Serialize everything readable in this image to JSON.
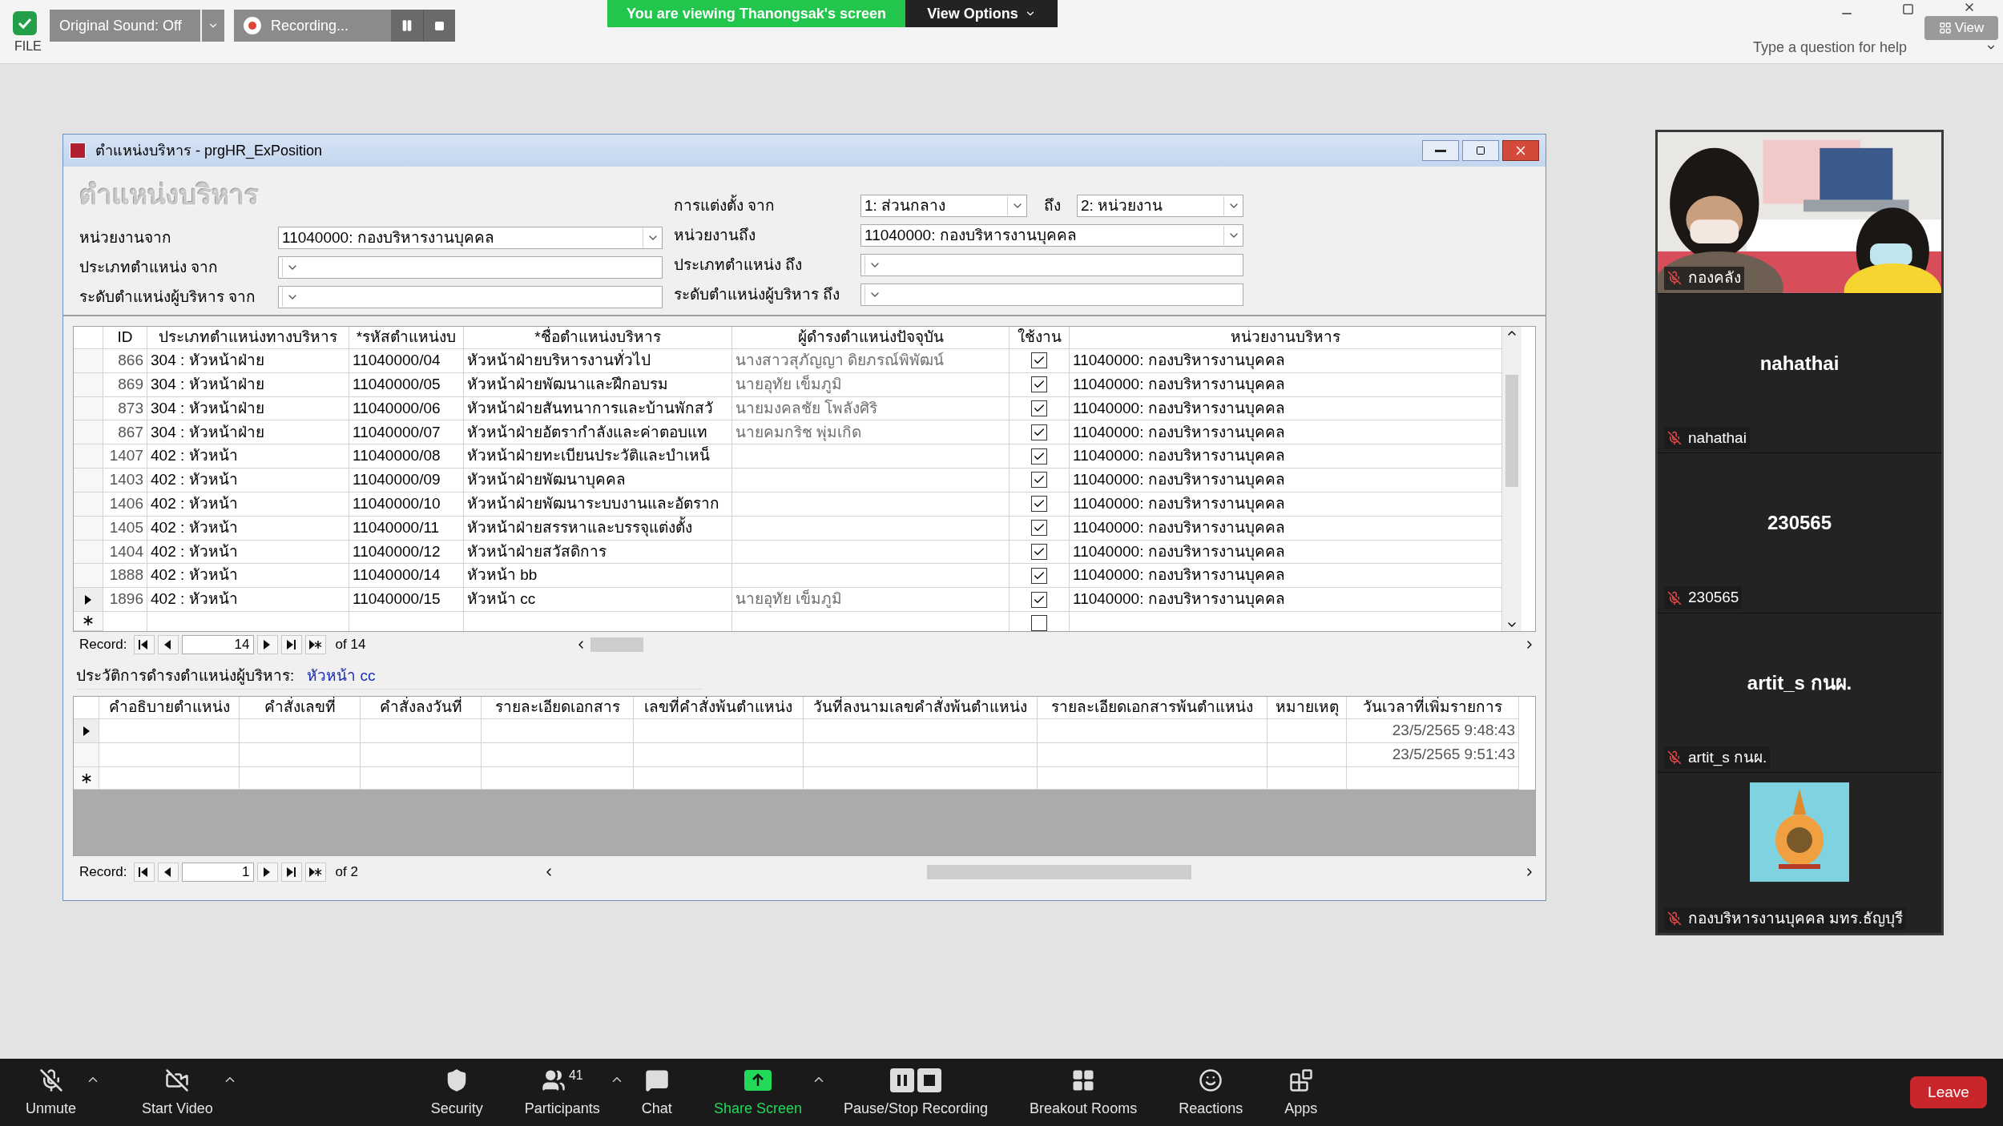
{
  "zoom_top": {
    "sound_button": "Original Sound: Off",
    "recording": "Recording...",
    "banner": "You are viewing Thanongsak's screen",
    "view_options": "View Options",
    "view_button": "View"
  },
  "access": {
    "file_tab": "FILE",
    "help_placeholder": "Type a question for help"
  },
  "form": {
    "title": "ตำแหน่งบริหาร - prgHR_ExPosition",
    "heading": "ตำแหน่งบริหาร",
    "appoint": {
      "label": "การแต่งตั้ง จาก",
      "from": "1: ส่วนกลาง",
      "to_label": "ถึง",
      "to": "2: หน่วยงาน"
    },
    "filters_left": [
      {
        "label": "หน่วยงานจาก",
        "value": "11040000: กองบริหารงานบุคคล"
      },
      {
        "label": "ประเภทตำแหน่ง จาก"
      },
      {
        "label": "ระดับตำแหน่งผู้บริหาร จาก"
      }
    ],
    "filters_right": [
      {
        "label": "หน่วยงานถึง",
        "value": "11040000: กองบริหารงานบุคคล"
      },
      {
        "label": "ประเภทตำแหน่ง ถึง"
      },
      {
        "label": "ระดับตำแหน่งผู้บริหาร ถึง"
      }
    ],
    "grid": {
      "columns": [
        "ID",
        "ประเภทตำแหน่งทางบริหาร",
        "*รหัสตำแหน่งบ",
        "*ชื่อตำแหน่งบริหาร",
        "ผู้ดำรงตำแหน่งปัจจุบัน",
        "ใช้งาน",
        "หน่วยงานบริหาร"
      ],
      "rows": [
        {
          "id": "866",
          "type": "304 : หัวหน้าฝ่าย",
          "code": "11040000/04",
          "name": "หัวหน้าฝ่ายบริหารงานทั่วไป",
          "holder": "นางสาวสุภัญญา ดิยภรณ์พิพัฒน์",
          "active": true,
          "unit": "11040000: กองบริหารงานบุคคล",
          "selected": false
        },
        {
          "id": "869",
          "type": "304 : หัวหน้าฝ่าย",
          "code": "11040000/05",
          "name": "หัวหน้าฝ่ายพัฒนาและฝึกอบรม",
          "holder": "นายอุทัย เข็มภูมิ",
          "active": true,
          "unit": "11040000: กองบริหารงานบุคคล",
          "selected": false
        },
        {
          "id": "873",
          "type": "304 : หัวหน้าฝ่าย",
          "code": "11040000/06",
          "name": "หัวหน้าฝ่ายสันทนาการและบ้านพักสวั",
          "holder": "นายมงคลชัย โพลังศิริ",
          "active": true,
          "unit": "11040000: กองบริหารงานบุคคล",
          "selected": false
        },
        {
          "id": "867",
          "type": "304 : หัวหน้าฝ่าย",
          "code": "11040000/07",
          "name": "หัวหน้าฝ่ายอัตรากำลังและค่าตอบแท",
          "holder": "นายคมกริช พุ่มเกิด",
          "active": true,
          "unit": "11040000: กองบริหารงานบุคคล",
          "selected": false
        },
        {
          "id": "1407",
          "type": "402 : หัวหน้า",
          "code": "11040000/08",
          "name": "หัวหน้าฝ่ายทะเบียนประวัติและบำเหน็",
          "active": true,
          "unit": "11040000: กองบริหารงานบุคคล",
          "selected": false
        },
        {
          "id": "1403",
          "type": "402 : หัวหน้า",
          "code": "11040000/09",
          "name": "หัวหน้าฝ่ายพัฒนาบุคคล",
          "active": true,
          "unit": "11040000: กองบริหารงานบุคคล",
          "selected": false
        },
        {
          "id": "1406",
          "type": "402 : หัวหน้า",
          "code": "11040000/10",
          "name": "หัวหน้าฝ่ายพัฒนาระบบงานและอัตราก",
          "active": true,
          "unit": "11040000: กองบริหารงานบุคคล",
          "selected": false
        },
        {
          "id": "1405",
          "type": "402 : หัวหน้า",
          "code": "11040000/11",
          "name": "หัวหน้าฝ่ายสรรหาและบรรจุแต่งตั้ง",
          "active": true,
          "unit": "11040000: กองบริหารงานบุคคล",
          "selected": false
        },
        {
          "id": "1404",
          "type": "402 : หัวหน้า",
          "code": "11040000/12",
          "name": "หัวหน้าฝ่ายสวัสดิการ",
          "active": true,
          "unit": "11040000: กองบริหารงานบุคคล",
          "selected": false
        },
        {
          "id": "1888",
          "type": "402 : หัวหน้า",
          "code": "11040000/14",
          "name": "หัวหน้า bb",
          "active": true,
          "unit": "11040000: กองบริหารงานบุคคล",
          "selected": false
        },
        {
          "id": "1896",
          "type": "402 : หัวหน้า",
          "code": "11040000/15",
          "name": "หัวหน้า cc",
          "holder": "นายอุทัย เข็มภูมิ",
          "active": true,
          "unit": "11040000: กองบริหารงานบุคคล",
          "selected": true
        }
      ],
      "new_row_active": false,
      "nav": {
        "label": "Record:",
        "current": "14",
        "total": "of 14"
      }
    },
    "history": {
      "label": "ประวัติการดำรงตำแหน่งผู้บริหาร:",
      "value": "หัวหน้า cc",
      "columns": [
        "คำอธิบายตำแหน่ง",
        "คำสั่งเลขที่",
        "คำสั่งลงวันที่",
        "รายละเอียดเอกสาร",
        "เลขที่คำสั่งพ้นตำแหน่ง",
        "วันที่ลงนามเลขคำสั่งพ้นตำแหน่ง",
        "รายละเอียดเอกสารพ้นตำแหน่ง",
        "หมายเหตุ",
        "วันเวลาที่เพิ่มรายการ"
      ],
      "rows": [
        {
          "selected": true,
          "added": "23/5/2565 9:48:43"
        },
        {
          "selected": false,
          "added": "23/5/2565 9:51:43"
        }
      ],
      "nav": {
        "label": "Record:",
        "current": "1",
        "total": "of 2"
      }
    }
  },
  "participants": [
    {
      "kind": "video",
      "label": "กองคลัง"
    },
    {
      "kind": "name",
      "display": "nahathai",
      "label": "nahathai"
    },
    {
      "kind": "name",
      "display": "230565",
      "label": "230565"
    },
    {
      "kind": "name",
      "display": "artit_s กนผ.",
      "label": "artit_s กนผ."
    },
    {
      "kind": "logo",
      "label": "กองบริหารงานบุคคล มทร.ธัญบุรี"
    }
  ],
  "toolbar": [
    {
      "kind": "mic",
      "label": "Unmute",
      "caret": true
    },
    {
      "kind": "video",
      "label": "Start Video",
      "caret": true
    },
    {
      "kind": "security",
      "label": "Security",
      "caret": false
    },
    {
      "kind": "participants",
      "label": "Participants",
      "count": "41",
      "caret": true
    },
    {
      "kind": "chat",
      "label": "Chat",
      "caret": false
    },
    {
      "kind": "share",
      "label": "Share Screen",
      "caret": true
    },
    {
      "kind": "record",
      "label": "Pause/Stop Recording",
      "caret": false
    },
    {
      "kind": "breakout",
      "label": "Breakout Rooms",
      "caret": false
    },
    {
      "kind": "reactions",
      "label": "Reactions",
      "caret": false
    },
    {
      "kind": "apps",
      "label": "Apps",
      "caret": false
    }
  ],
  "leave_button": "Leave"
}
